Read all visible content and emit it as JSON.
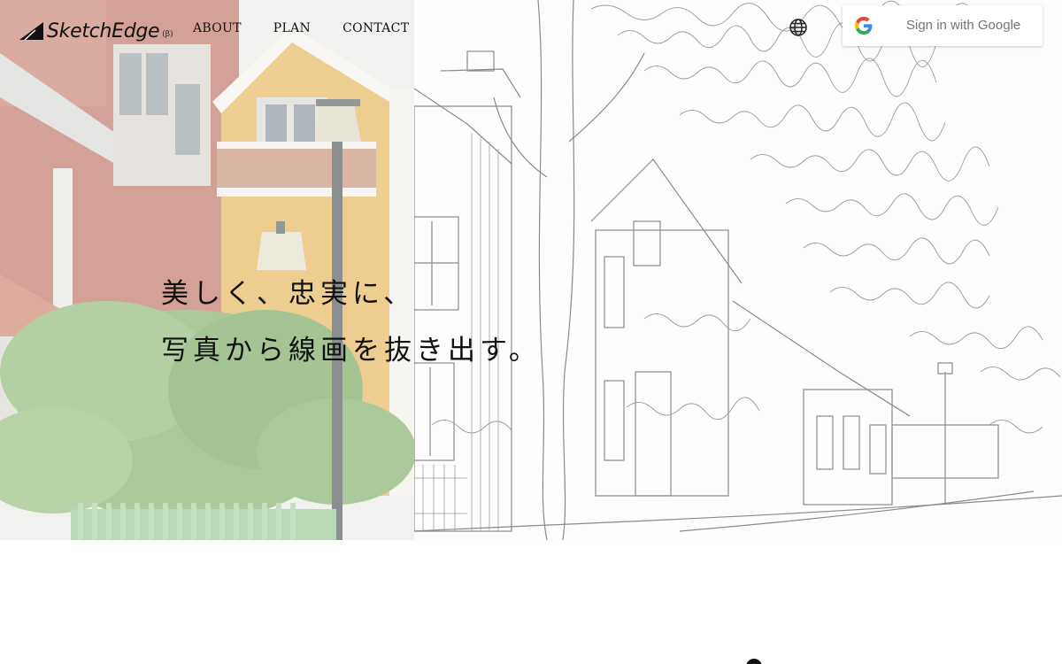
{
  "brand": {
    "name": "SketchEdge",
    "beta": "(β)"
  },
  "nav": {
    "items": [
      {
        "label": "ABOUT"
      },
      {
        "label": "PLAN"
      },
      {
        "label": "CONTACT"
      }
    ]
  },
  "header": {
    "language_icon": "globe-icon"
  },
  "auth": {
    "google_label": "Sign in with Google",
    "icon": "google-g-icon"
  },
  "hero": {
    "headline_line1": "美しく、忠実に、",
    "headline_line2": "写真から線画を抜き出す。"
  },
  "colors": {
    "text": "#111111",
    "google_label": "#757575",
    "google_blue": "#4285F4",
    "google_red": "#EA4335",
    "google_yellow": "#FBBC05",
    "google_green": "#34A853",
    "house_yellow": "#E3AE4C",
    "house_red": "#9B4A3A",
    "foliage": "#5E9A3E"
  }
}
